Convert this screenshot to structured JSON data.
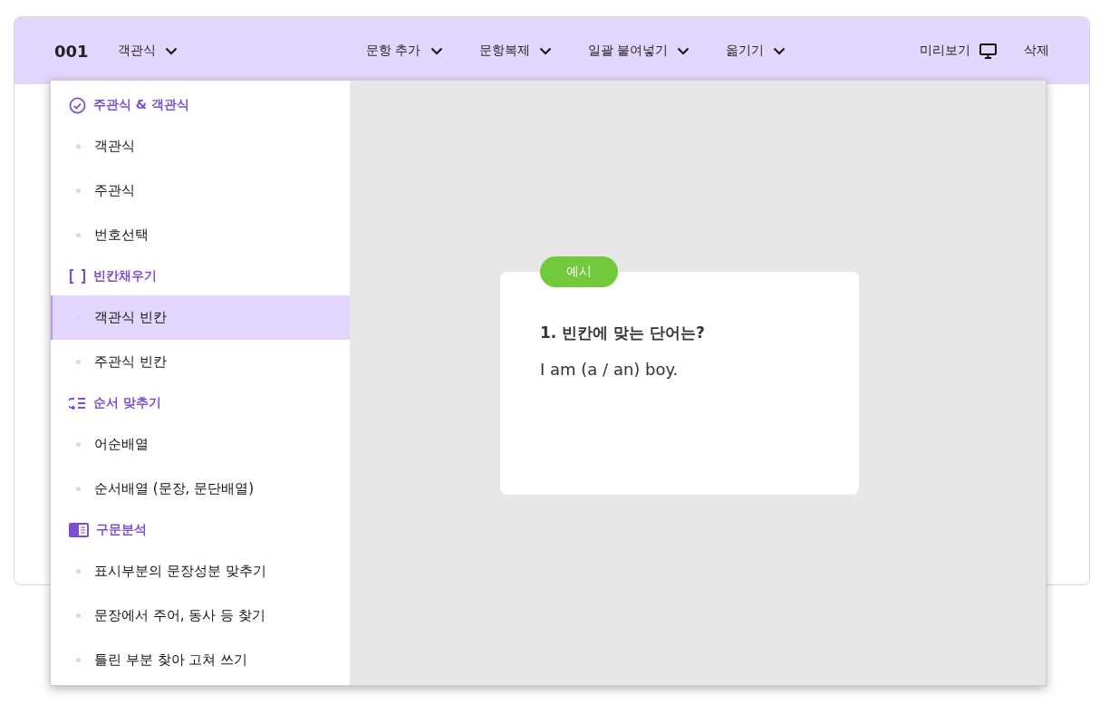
{
  "header": {
    "number": "001",
    "type_dropdown": "객관식",
    "menus": [
      "문항 추가",
      "문항복제",
      "일괄 붙여넣기",
      "옮기기"
    ],
    "preview": "미리보기",
    "delete": "삭제"
  },
  "type_menu": {
    "groups": [
      {
        "kind": "check",
        "title": "주관식 & 객관식",
        "items": [
          {
            "label": "객관식",
            "selected": false
          },
          {
            "label": "주관식",
            "selected": false
          },
          {
            "label": "번호선택",
            "selected": false
          }
        ]
      },
      {
        "kind": "blank",
        "title": "빈칸채우기",
        "items": [
          {
            "label": "객관식 빈칸",
            "selected": true
          },
          {
            "label": "주관식 빈칸",
            "selected": false
          }
        ]
      },
      {
        "kind": "order",
        "title": "순서 맞추기",
        "items": [
          {
            "label": "어순배열",
            "selected": false
          },
          {
            "label": "순서배열 (문장, 문단배열)",
            "selected": false
          }
        ]
      },
      {
        "kind": "syntax",
        "title": "구문분석",
        "items": [
          {
            "label": "표시부분의 문장성분 맞추기",
            "selected": false
          },
          {
            "label": "문장에서 주어, 동사 등 찾기",
            "selected": false
          },
          {
            "label": "틀린 부분 찾아 고쳐 쓰기",
            "selected": false
          }
        ]
      }
    ],
    "example": {
      "badge": "예시",
      "question": "1. 빈칸에 맞는 단어는?",
      "sentence": "I am (a / an) boy."
    }
  }
}
